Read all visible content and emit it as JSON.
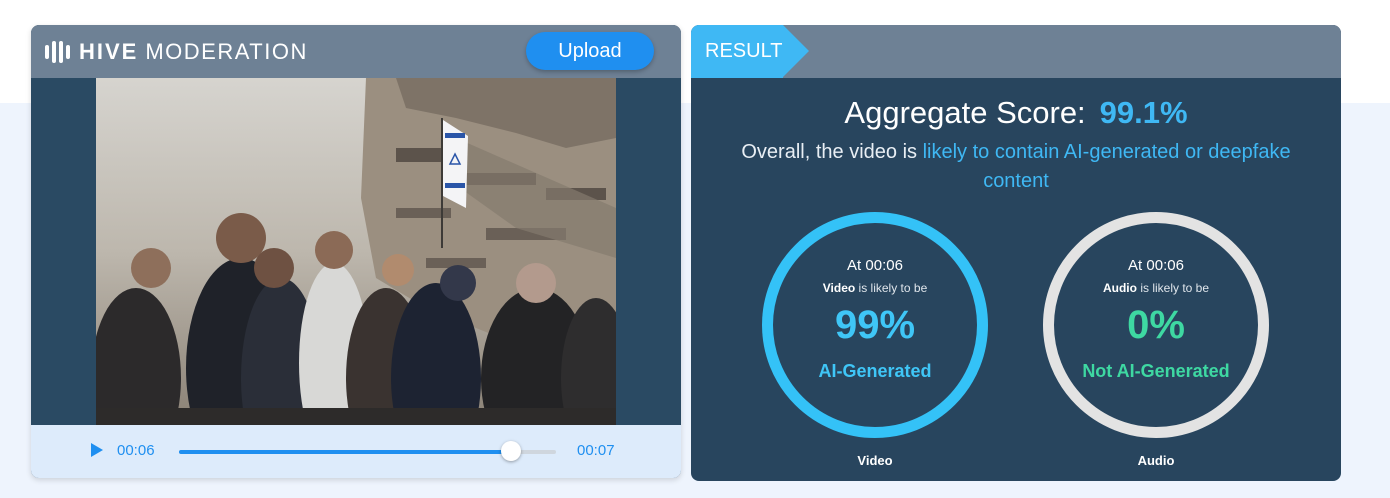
{
  "header": {
    "logo_brand": "HIVE",
    "logo_product": "MODERATION",
    "upload_label": "Upload"
  },
  "player": {
    "current_time": "00:06",
    "duration": "00:07",
    "progress_fraction": 0.88
  },
  "result": {
    "tab_label": "RESULT",
    "aggregate_label": "Aggregate Score:",
    "aggregate_value": "99.1%",
    "overall_prefix": "Overall, the video is ",
    "overall_highlight": "likely to contain AI-generated or deepfake content",
    "video": {
      "at_time": "At 00:06",
      "media": "Video",
      "likely_suffix": " is likely to be",
      "percent": "99%",
      "percent_value": 99,
      "verdict": "AI-Generated",
      "caption": "Video"
    },
    "audio": {
      "at_time": "At 00:06",
      "media": "Audio",
      "likely_suffix": " is likely to be",
      "percent": "0%",
      "percent_value": 0,
      "verdict": "Not AI-Generated",
      "caption": "Audio"
    }
  },
  "colors": {
    "accent": "#1f8ff0",
    "result_blue": "#3fb8f4",
    "video_ring": "#34c2f7",
    "audio_ring": "#e3e3e3",
    "audio_verdict": "#3ed8a2"
  }
}
